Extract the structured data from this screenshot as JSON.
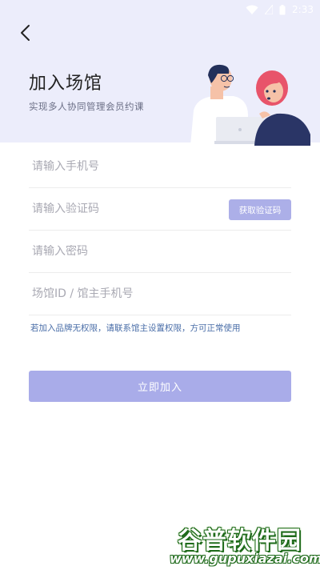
{
  "status_bar": {
    "time": "2:33"
  },
  "header": {
    "title": "加入场馆",
    "subtitle": "实现多人协同管理会员约课"
  },
  "form": {
    "phone": {
      "placeholder": "请输入手机号",
      "value": ""
    },
    "code": {
      "placeholder": "请输入验证码",
      "value": "",
      "button_label": "获取验证码"
    },
    "password": {
      "placeholder": "请输入密码",
      "value": ""
    },
    "venue_id": {
      "placeholder": "场馆ID / 馆主手机号",
      "value": ""
    }
  },
  "hint": "若加入品牌无权限，请联系馆主设置权限，方可正常使用",
  "submit_label": "立即加入",
  "watermark": {
    "brand": "谷普软件园",
    "url": "www.gupuxiazai.com"
  },
  "colors": {
    "header_bg": "#ecedfb",
    "primary_button": "#a9ace9",
    "hint_text": "#4a6ea8"
  },
  "icons": {
    "back": "chevron-left-icon",
    "wifi": "wifi-icon",
    "signal": "signal-icon",
    "battery": "battery-icon"
  }
}
